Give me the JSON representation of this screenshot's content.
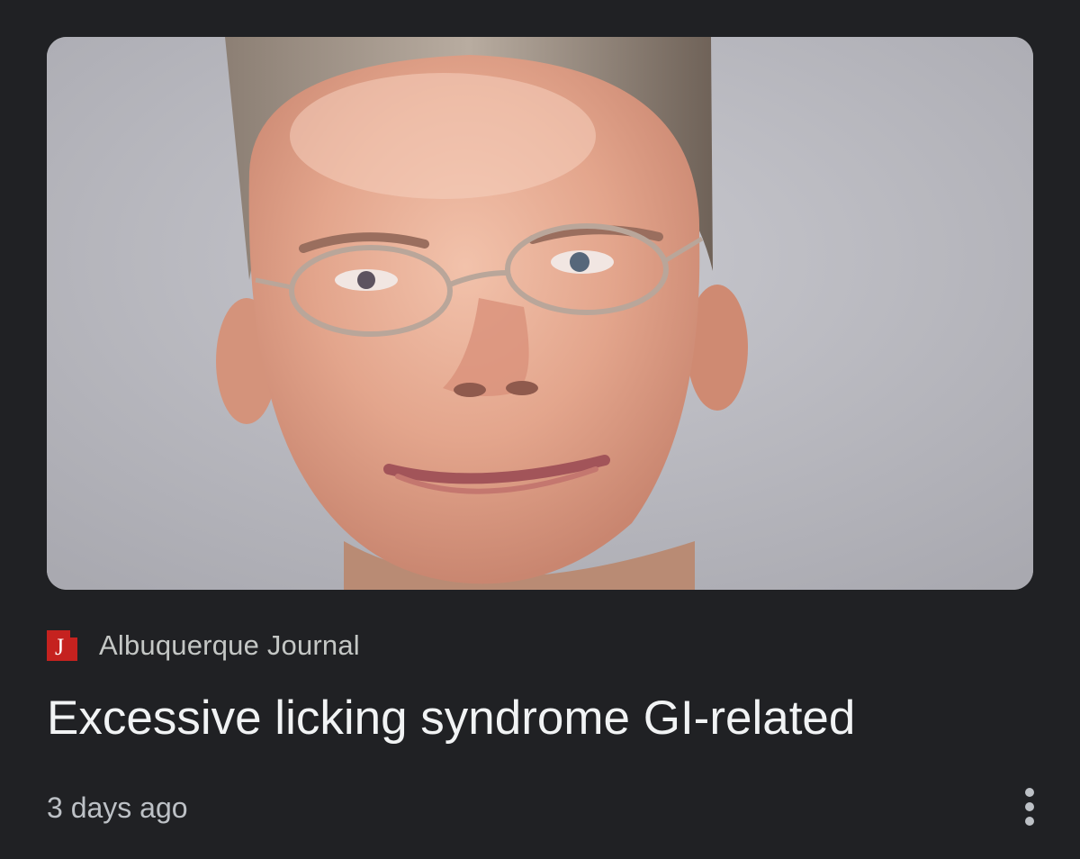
{
  "article": {
    "source_name": "Albuquerque Journal",
    "source_logo_letter": "J",
    "headline": "Excessive licking syndrome GI-related",
    "timestamp": "3 days ago"
  },
  "icons": {
    "source_logo": "albuquerque-journal-logo",
    "more_menu": "more-vert-icon"
  },
  "colors": {
    "background": "#202124",
    "logo_red": "#c5221f",
    "headline": "#f1f3f4",
    "secondary_text": "#bdc1c6"
  }
}
